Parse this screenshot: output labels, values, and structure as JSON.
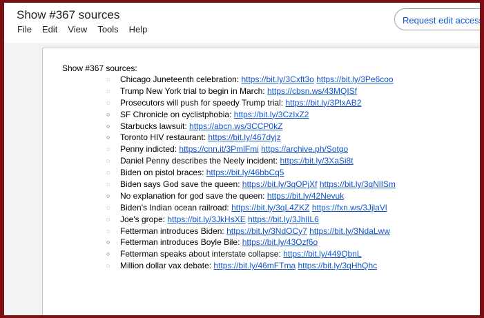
{
  "doc_title": "Show #367 sources",
  "menu": [
    "File",
    "Edit",
    "View",
    "Tools",
    "Help"
  ],
  "request_button": "Request edit access",
  "heading": "Show #367 sources:",
  "items": [
    {
      "bullet": "◌",
      "label": "Chicago Juneteenth celebration:",
      "links": [
        "https://bit.ly/3Cxft3o",
        "https://bit.ly/3Pe6coo"
      ]
    },
    {
      "bullet": "◌",
      "label": "Trump New York trial to begin in March:",
      "links": [
        "https://cbsn.ws/43MQISf"
      ]
    },
    {
      "bullet": "◌",
      "label": "Prosecutors will push for speedy Trump trial:",
      "links": [
        "https://bit.ly/3PlxAB2"
      ]
    },
    {
      "bullet": "○",
      "label": "SF Chronicle on cyclistphobia:",
      "links": [
        "https://bit.ly/3CzIxZ2"
      ]
    },
    {
      "bullet": "○",
      "label": "Starbucks lawsuit:",
      "links": [
        "https://abcn.ws/3CCP0kZ"
      ]
    },
    {
      "bullet": "○",
      "label": "Toronto HIV restaurant:",
      "links": [
        "https://bit.ly/467dyjz"
      ]
    },
    {
      "bullet": "◌",
      "label": "Penny indicted:",
      "links": [
        "https://cnn.it/3PmlFmi",
        "https://archive.ph/Sotgo"
      ]
    },
    {
      "bullet": "◌",
      "label": "Daniel Penny describes the Neely incident:",
      "links": [
        "https://bit.ly/3XaSi8t"
      ]
    },
    {
      "bullet": "◌",
      "label": "Biden on pistol braces:",
      "links": [
        "https://bit.ly/46bbCq5"
      ]
    },
    {
      "bullet": "◌",
      "label": "Biden says God save the queen:",
      "links": [
        "https://bit.ly/3qOPjXf",
        "https://bit.ly/3qNlISm"
      ]
    },
    {
      "bullet": "○",
      "label": "No explanation for god save the queen:",
      "links": [
        "https://bit.ly/42Nevuk"
      ]
    },
    {
      "bullet": "◌",
      "label": "Biden's Indian ocean railroad:",
      "links": [
        "https://bit.ly/3qL4ZKZ",
        "https://fxn.ws/3JjlaVl"
      ]
    },
    {
      "bullet": "◌",
      "label": "Joe's grope:",
      "links": [
        "https://bit.ly/3JkHsXE",
        "https://bit.ly/3JhlIL6"
      ]
    },
    {
      "bullet": "◌",
      "label": "Fetterman introduces Biden:",
      "links": [
        "https://bit.ly/3NdOCy7",
        "https://bit.ly/3NdaLww"
      ]
    },
    {
      "bullet": "○",
      "label": "Fetterman introduces Boyle Bile:",
      "links": [
        "https://bit.ly/43Ozf6o"
      ]
    },
    {
      "bullet": "○",
      "label": "Fetterman speaks about interstate collapse:",
      "links": [
        "https://bit.ly/449QbnL"
      ]
    },
    {
      "bullet": "◌",
      "label": "Million dollar vax debate:",
      "links": [
        "https://bit.ly/46mFTma",
        "https://bit.ly/3qHhQhc"
      ]
    }
  ]
}
